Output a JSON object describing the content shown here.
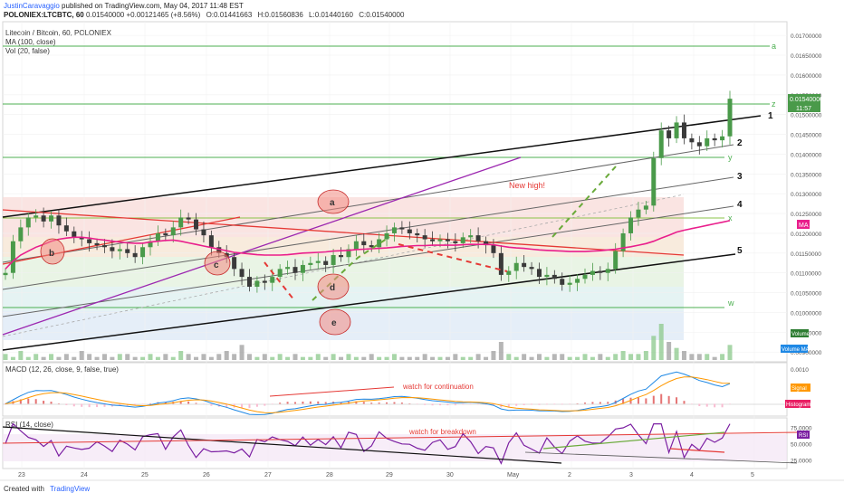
{
  "header": {
    "author": "JustinCaravaggio",
    "published": "published on TradingView.com, May 04, 2017 11:48 EST",
    "symbol": "POLONIEX:LTCBTC, 60",
    "last": "0.01540000",
    "change": "+0.00121465 (+8.56%)",
    "open_label": "O:",
    "open": "0.01441663",
    "high_label": "H:",
    "high": "0.01560836",
    "low_label": "L:",
    "low": "0.01440160",
    "close_label": "C:",
    "close": "0.01540000"
  },
  "legend": {
    "title": "Litecoin / Bitcoin, 60, POLONIEX",
    "ma": "MA (100, close)",
    "vol": "Vol (20, false)"
  },
  "footer": {
    "created": "Created with",
    "brand": "TradingView"
  },
  "colors": {
    "up": "#26a69a",
    "down": "#ef5350",
    "candle_up": "#4a9a4a",
    "candle_down": "#3a3a3a",
    "ma": "#e91e8c",
    "accent": "#2962ff"
  },
  "chart_data": [
    {
      "type": "line",
      "name": "price",
      "y_axis_ticks": [
        "0.01700000",
        "0.01650000",
        "0.01600000",
        "0.01550000",
        "0.01500000",
        "0.01450000",
        "0.01400000",
        "0.01350000",
        "0.01300000",
        "0.01250000",
        "0.01200000",
        "0.01150000",
        "0.01100000",
        "0.01050000",
        "0.01000000",
        "0.00950000",
        "0.00900000"
      ],
      "ylim": [
        0.0088,
        0.0173
      ],
      "x_ticks": [
        "23",
        "24",
        "25",
        "26",
        "27",
        "28",
        "29",
        "30",
        "May",
        "2",
        "3",
        "4",
        "5"
      ],
      "last_price_label": "0.01540000",
      "countdown": "11:57",
      "x": [
        0,
        2,
        4,
        6,
        8,
        10,
        12,
        14,
        16,
        18,
        20,
        22,
        24,
        26,
        28,
        30,
        32,
        34,
        36,
        38,
        40,
        42,
        44,
        46,
        48,
        50,
        52,
        54,
        56,
        58,
        60,
        62,
        64,
        66,
        68,
        70,
        72,
        74,
        76,
        78,
        80,
        82,
        84,
        86,
        88,
        90,
        92,
        94,
        96,
        98,
        100,
        102,
        104,
        106,
        108,
        110,
        112,
        114,
        116,
        118,
        120,
        122,
        124,
        126,
        128,
        130,
        132,
        134,
        136,
        138,
        140,
        142,
        144,
        146,
        148,
        150,
        152,
        154,
        156,
        158,
        160,
        162,
        164,
        166,
        168,
        170,
        172,
        174,
        176,
        178,
        180,
        182,
        184,
        186,
        188,
        190
      ],
      "close": [
        0.011,
        0.0118,
        0.01215,
        0.0124,
        0.01245,
        0.0123,
        0.01245,
        0.0122,
        0.01205,
        0.0119,
        0.01185,
        0.01175,
        0.0117,
        0.01165,
        0.01155,
        0.0116,
        0.0115,
        0.0114,
        0.01165,
        0.0118,
        0.012,
        0.01195,
        0.01215,
        0.0124,
        0.01235,
        0.0121,
        0.01195,
        0.01165,
        0.0115,
        0.0114,
        0.0111,
        0.0109,
        0.01065,
        0.0108,
        0.01075,
        0.0109,
        0.0111,
        0.01115,
        0.011,
        0.0112,
        0.01125,
        0.0113,
        0.0112,
        0.01145,
        0.0114,
        0.0116,
        0.0118,
        0.0117,
        0.01165,
        0.01185,
        0.012,
        0.01215,
        0.0121,
        0.012,
        0.01195,
        0.01185,
        0.0118,
        0.01185,
        0.0118,
        0.01175,
        0.0119,
        0.01195,
        0.0118,
        0.0117,
        0.0115,
        0.01095,
        0.01105,
        0.01125,
        0.01115,
        0.0111,
        0.0109,
        0.01095,
        0.01085,
        0.0107,
        0.01075,
        0.01085,
        0.01095,
        0.01105,
        0.011,
        0.0111,
        0.01155,
        0.012,
        0.0124,
        0.0126,
        0.0127,
        0.0139,
        0.0146,
        0.0144,
        0.0148,
        0.0144,
        0.0143,
        0.0142,
        0.0144,
        0.01435,
        0.01445,
        0.0154
      ],
      "ma100": [
        0.0111,
        0.0113,
        0.01145,
        0.01155,
        0.01165,
        0.01172,
        0.0118,
        0.01185,
        0.01188,
        0.0119,
        0.0119,
        0.01188,
        0.01185,
        0.01183,
        0.0118,
        0.01178,
        0.01176,
        0.01175,
        0.01175,
        0.01178,
        0.0118,
        0.01182,
        0.01183,
        0.0118,
        0.01176,
        0.01172,
        0.01168,
        0.01164,
        0.0116,
        0.01156,
        0.01152,
        0.0115,
        0.01148,
        0.01146,
        0.01145,
        0.01145,
        0.01145,
        0.01146,
        0.01148,
        0.0115,
        0.01151,
        0.01152,
        0.01153,
        0.01155,
        0.01156,
        0.01157,
        0.01159,
        0.0116,
        0.01161,
        0.01162,
        0.01163,
        0.01165,
        0.01167,
        0.01168,
        0.01169,
        0.01169,
        0.0117,
        0.0117,
        0.0117,
        0.0117,
        0.01171,
        0.01172,
        0.01172,
        0.01172,
        0.01171,
        0.01168,
        0.01165,
        0.01163,
        0.01162,
        0.0116,
        0.01158,
        0.01157,
        0.01156,
        0.01155,
        0.01154,
        0.01154,
        0.01154,
        0.01155,
        0.01156,
        0.01158,
        0.0116,
        0.01163,
        0.01166,
        0.0117,
        0.01174,
        0.0118,
        0.01188,
        0.01195,
        0.01203,
        0.01208,
        0.01212,
        0.01216,
        0.0122,
        0.01224,
        0.01228,
        0.01232
      ]
    },
    {
      "type": "bar",
      "name": "Volume",
      "labels": [
        "Volume",
        "Volume MA"
      ],
      "values": [
        2,
        1,
        3,
        1,
        2,
        1,
        2,
        1,
        2,
        1,
        3,
        2,
        1,
        2,
        1,
        2,
        2,
        1,
        1,
        2,
        1,
        2,
        1,
        3,
        2,
        1,
        2,
        1,
        2,
        3,
        2,
        5,
        2,
        1,
        2,
        1,
        2,
        1,
        2,
        1,
        1,
        2,
        1,
        2,
        1,
        2,
        1,
        1,
        2,
        1,
        1,
        2,
        1,
        1,
        1,
        2,
        1,
        1,
        1,
        2,
        1,
        1,
        2,
        1,
        3,
        6,
        2,
        1,
        2,
        1,
        2,
        1,
        2,
        2,
        1,
        1,
        2,
        1,
        2,
        1,
        2,
        3,
        2,
        2,
        3,
        8,
        12,
        6,
        4,
        3,
        2,
        2,
        2,
        1,
        2,
        5
      ]
    },
    {
      "type": "line",
      "name": "MACD",
      "title": "MACD (12, 26, close, 9, false, true)",
      "labels": [
        "Signal",
        "Histogram"
      ],
      "y_axis_ticks": [
        "0.0010",
        "0.0005",
        "0.0000"
      ],
      "ylim": [
        -0.0003,
        0.0011
      ]
    },
    {
      "type": "line",
      "name": "RSI",
      "title": "RSI (14, close)",
      "labels": [
        "RSI"
      ],
      "y_axis_ticks": [
        "75.0000",
        "50.0000",
        "25.0000"
      ],
      "ylim": [
        15,
        85
      ]
    }
  ],
  "annotations": {
    "circles": [
      "a",
      "b",
      "c",
      "d",
      "e"
    ],
    "levels": [
      "a",
      "z",
      "y",
      "x",
      "w"
    ],
    "channels": [
      "1",
      "2",
      "3",
      "4",
      "5"
    ],
    "new_high": "New high!",
    "macd_note": "watch for continuation",
    "rsi_note": "watch for breakdown",
    "ma_tag": "MA"
  }
}
